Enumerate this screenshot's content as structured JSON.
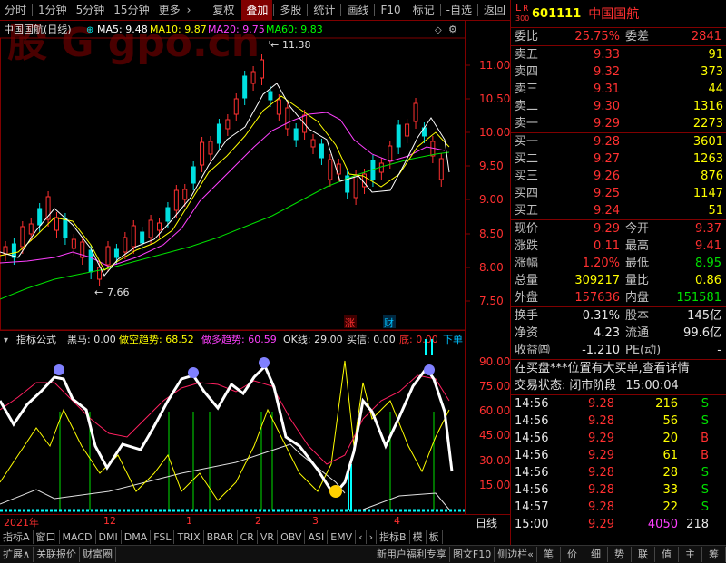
{
  "toolbar": {
    "left": [
      "分时",
      "1分钟",
      "5分钟",
      "15分钟",
      "更多",
      "›"
    ],
    "right": [
      "复权",
      "叠加",
      "多股",
      "统计",
      "画线",
      "F10",
      "标记",
      "-自选",
      "返回"
    ],
    "active": "叠加"
  },
  "chart": {
    "title": "中国国航(日线)",
    "ma": [
      {
        "label": "MA5: 9.48",
        "color": "#ffffff"
      },
      {
        "label": "MA10: 9.87",
        "color": "#ffff00"
      },
      {
        "label": "MA20: 9.75",
        "color": "#ff40ff"
      },
      {
        "label": "MA60: 9.83",
        "color": "#00ff00"
      }
    ],
    "watermark": "股 G gpo.cn",
    "price_ticks": [
      "11.00",
      "10.50",
      "10.00",
      "9.50",
      "9.00",
      "8.50",
      "8.00",
      "7.50"
    ],
    "high_label": "11.38",
    "low_label": "7.66",
    "badges": [
      "涨",
      "财"
    ]
  },
  "indicator": {
    "title": "指标公式",
    "items": [
      {
        "text": "黑马: 0.00",
        "color": "#e0e0e0"
      },
      {
        "text": "做空趋势: 68.52",
        "color": "#ffff00"
      },
      {
        "text": "做多趋势: 60.59",
        "color": "#ff40ff"
      },
      {
        "text": "OK线: 29.00",
        "color": "#e0e0e0"
      },
      {
        "text": "买信: 0.00",
        "color": "#e0e0e0"
      },
      {
        "text": "底: 0.00",
        "color": "#ff3030"
      },
      {
        "text": "下单",
        "color": "#00c0ff"
      }
    ],
    "ticks": [
      "90.00",
      "75.00",
      "60.00",
      "45.00",
      "30.00",
      "15.00"
    ]
  },
  "xaxis": {
    "labels": [
      "2021年",
      "12",
      "1",
      "2",
      "3",
      "4"
    ],
    "period": "日线"
  },
  "tabs": [
    "指标A",
    "窗口",
    "MACD",
    "DMI",
    "DMA",
    "FSL",
    "TRIX",
    "BRAR",
    "CR",
    "VR",
    "OBV",
    "ASI",
    "EMV",
    "‹",
    "›",
    "指标B",
    "模",
    "板"
  ],
  "status": [
    "扩展∧",
    "关联报价",
    "财富圈"
  ],
  "status_right": [
    "新用户福利专享",
    "图文F10",
    "侧边栏«",
    "笔",
    "价",
    "细",
    "势",
    "联",
    "值",
    "主",
    "筹"
  ],
  "quote": {
    "lr": [
      "L",
      "R",
      "300"
    ],
    "code": "601111",
    "name": "中国国航",
    "weibi_label": "委比",
    "weibi": "25.75%",
    "weicha_label": "委差",
    "weicha": "2841",
    "sells": [
      {
        "l": "卖五",
        "p": "9.33",
        "v": "91"
      },
      {
        "l": "卖四",
        "p": "9.32",
        "v": "373"
      },
      {
        "l": "卖三",
        "p": "9.31",
        "v": "44"
      },
      {
        "l": "卖二",
        "p": "9.30",
        "v": "1316"
      },
      {
        "l": "卖一",
        "p": "9.29",
        "v": "2273"
      }
    ],
    "buys": [
      {
        "l": "买一",
        "p": "9.28",
        "v": "3601"
      },
      {
        "l": "买二",
        "p": "9.27",
        "v": "1263"
      },
      {
        "l": "买三",
        "p": "9.26",
        "v": "876"
      },
      {
        "l": "买四",
        "p": "9.25",
        "v": "1147"
      },
      {
        "l": "买五",
        "p": "9.24",
        "v": "51"
      }
    ],
    "stats": [
      {
        "l1": "现价",
        "v1": "9.29",
        "c1": "red",
        "l2": "今开",
        "v2": "9.37",
        "c2": "red"
      },
      {
        "l1": "涨跌",
        "v1": "0.11",
        "c1": "red",
        "l2": "最高",
        "v2": "9.41",
        "c2": "red"
      },
      {
        "l1": "涨幅",
        "v1": "1.20%",
        "c1": "red",
        "l2": "最低",
        "v2": "8.95",
        "c2": "grn"
      },
      {
        "l1": "总量",
        "v1": "309217",
        "c1": "yel",
        "l2": "量比",
        "v2": "0.86",
        "c2": "yel"
      },
      {
        "l1": "外盘",
        "v1": "157636",
        "c1": "red",
        "l2": "内盘",
        "v2": "151581",
        "c2": "grn"
      }
    ],
    "stats2": [
      {
        "l1": "换手",
        "v1": "0.31%",
        "l2": "股本",
        "v2": "145亿"
      },
      {
        "l1": "净资",
        "v1": "4.23",
        "l2": "流通",
        "v2": "99.6亿"
      },
      {
        "l1": "收益㈣",
        "v1": "-1.210",
        "l2": "PE(动)",
        "v2": "-"
      }
    ],
    "notice": "在买盘***位置有大买单,查看详情",
    "state_label": "交易状态:",
    "state": "闭市阶段",
    "state_time": "15:00:04",
    "ticks": [
      {
        "t": "14:56",
        "p": "9.28",
        "v": "216",
        "bs": "S"
      },
      {
        "t": "14:56",
        "p": "9.28",
        "v": "56",
        "bs": "S"
      },
      {
        "t": "14:56",
        "p": "9.29",
        "v": "20",
        "bs": "B"
      },
      {
        "t": "14:56",
        "p": "9.29",
        "v": "61",
        "bs": "B"
      },
      {
        "t": "14:56",
        "p": "9.28",
        "v": "28",
        "bs": "S"
      },
      {
        "t": "14:56",
        "p": "9.28",
        "v": "33",
        "bs": "S"
      },
      {
        "t": "14:57",
        "p": "9.28",
        "v": "22",
        "bs": "S"
      },
      {
        "t": "15:00",
        "p": "9.29",
        "v": "4050",
        "bs": "218"
      }
    ]
  }
}
